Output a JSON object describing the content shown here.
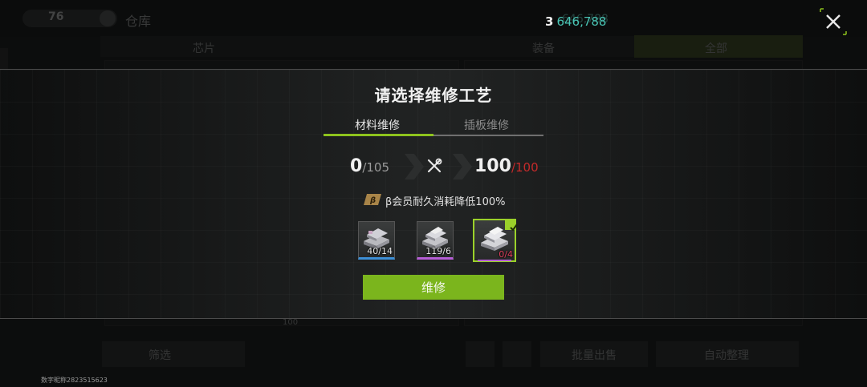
{
  "background": {
    "level_value": "76",
    "screen_title": "仓库",
    "tabs": [
      "芯片",
      "装备",
      "全部"
    ],
    "currency_value": "646,788",
    "scroll_value": "100",
    "bottom_buttons": [
      "筛选",
      "批量出售",
      "自动整理"
    ]
  },
  "header": {
    "currency_icon": "3",
    "currency_value": "646,788"
  },
  "modal": {
    "title": "请选择维修工艺",
    "tabs": [
      {
        "label": "材料维修",
        "active": true
      },
      {
        "label": "插板维修",
        "active": false
      }
    ],
    "current_progress": "0",
    "required_progress": "/105",
    "durability_current": "100",
    "durability_max": "/100",
    "member_badge": "β",
    "member_text": "β会员耐久消耗降低100%",
    "materials": [
      {
        "count": "40/14",
        "rarity_color": "#3d8fd6",
        "selected": false
      },
      {
        "count": "119/6",
        "rarity_color": "#b65ed6",
        "selected": false
      },
      {
        "count": "0/4",
        "rarity_color": "#b65ed6",
        "selected": true
      }
    ],
    "repair_button": "维修"
  },
  "footer": {
    "id_text": "数字昵称2823515623"
  },
  "colors": {
    "accent_green": "#8ec31d",
    "button_green": "#7bb51d",
    "currency_teal": "#49c4b4",
    "warning_red": "#c42a2a"
  },
  "icons": {
    "close": "close-icon",
    "repair": "wrench-screwdriver-icon",
    "material": "metal-ingots-icon",
    "check": "check-icon",
    "member": "beta-member-badge-icon"
  }
}
